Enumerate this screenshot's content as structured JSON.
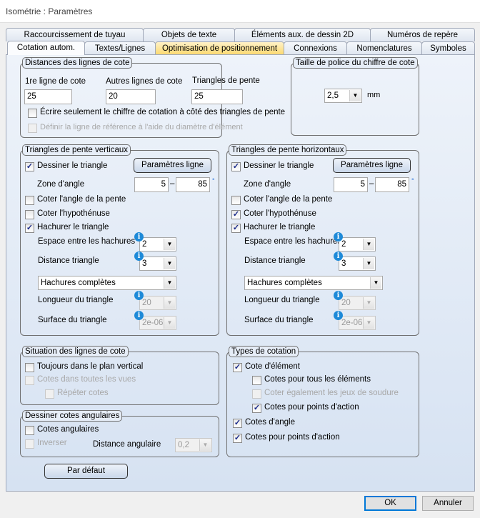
{
  "window": {
    "title": "Isométrie : Paramètres"
  },
  "tabs_row1": [
    "Raccourcissement de tuyau",
    "Objets de texte",
    "Éléments aux. de dessin 2D",
    "Numéros de repère"
  ],
  "tabs_row2": [
    "Cotation autom.",
    "Textes/Lignes",
    "Optimisation de positionnement",
    "Connexions",
    "Nomenclatures",
    "Symboles"
  ],
  "distances": {
    "title": "Distances des lignes de cote",
    "first_label": "1re ligne de cote",
    "first_value": "25",
    "other_label": "Autres lignes de cote",
    "other_value": "20",
    "tri_label": "Triangles de pente",
    "tri_value": "25",
    "write_only": "Écrire seulement le chiffre de cotation à côté des triangles de pente",
    "write_only_checked": false,
    "define_ref": "Définir la ligne de référence à l'aide du diamètre d'élément",
    "define_ref_checked": false
  },
  "font_size": {
    "title": "Taille de police du chiffre de cote",
    "value": "2,5",
    "unit": "mm"
  },
  "vertical": {
    "title": "Triangles de pente verticaux",
    "draw": "Dessiner le triangle",
    "draw_checked": true,
    "line_params": "Paramètres ligne",
    "zone": "Zone d'angle",
    "zone_min": "5",
    "zone_max": "85",
    "dash": "–",
    "deg": "°",
    "angle": "Coter l'angle de la pente",
    "angle_checked": false,
    "hyp": "Coter l'hypothénuse",
    "hyp_checked": false,
    "hatch": "Hachurer le triangle",
    "hatch_checked": true,
    "spacing": "Espace entre les hachures",
    "spacing_value": "2",
    "distance": "Distance triangle",
    "distance_value": "3",
    "hatch_type": "Hachures complètes",
    "length": "Longueur du triangle",
    "length_value": "20",
    "surface": "Surface du triangle",
    "surface_value": "2e-06"
  },
  "horizontal": {
    "title": "Triangles de pente horizontaux",
    "draw": "Dessiner le triangle",
    "draw_checked": true,
    "line_params": "Paramètres ligne",
    "zone": "Zone d'angle",
    "zone_min": "5",
    "zone_max": "85",
    "dash": "–",
    "deg": "°",
    "angle": "Coter l'angle de la pente",
    "angle_checked": false,
    "hyp": "Coter l'hypothénuse",
    "hyp_checked": true,
    "hatch": "Hachurer le triangle",
    "hatch_checked": true,
    "spacing": "Espace entre les hachures",
    "spacing_value": "2",
    "distance": "Distance triangle",
    "distance_value": "3",
    "hatch_type": "Hachures complètes",
    "length": "Longueur du triangle",
    "length_value": "20",
    "surface": "Surface du triangle",
    "surface_value": "2e-06"
  },
  "situation": {
    "title": "Situation des lignes de cote",
    "always": "Toujours dans le plan vertical",
    "always_checked": false,
    "all_views": "Cotes dans toutes les vues",
    "repeat": "Répéter cotes"
  },
  "angular": {
    "title": "Dessiner cotes angulaires",
    "angular": "Cotes angulaires",
    "angular_checked": false,
    "invert": "Inverser",
    "distance": "Distance angulaire",
    "distance_value": "0,2"
  },
  "types": {
    "title": "Types de cotation",
    "element": "Cote d'élément",
    "element_checked": true,
    "all_elements": "Cotes pour tous les éléments",
    "all_elements_checked": false,
    "welding": "Coter également les jeux de soudure",
    "action_sub": "Cotes pour points d'action",
    "action_sub_checked": true,
    "angle": "Cotes d'angle",
    "angle_checked": true,
    "action": "Cotes pour points d'action",
    "action_checked": true
  },
  "buttons": {
    "default": "Par défaut",
    "ok": "OK",
    "cancel": "Annuler"
  },
  "info_glyph": "i",
  "arrow_glyph": "▼",
  "check_glyph": "✓"
}
